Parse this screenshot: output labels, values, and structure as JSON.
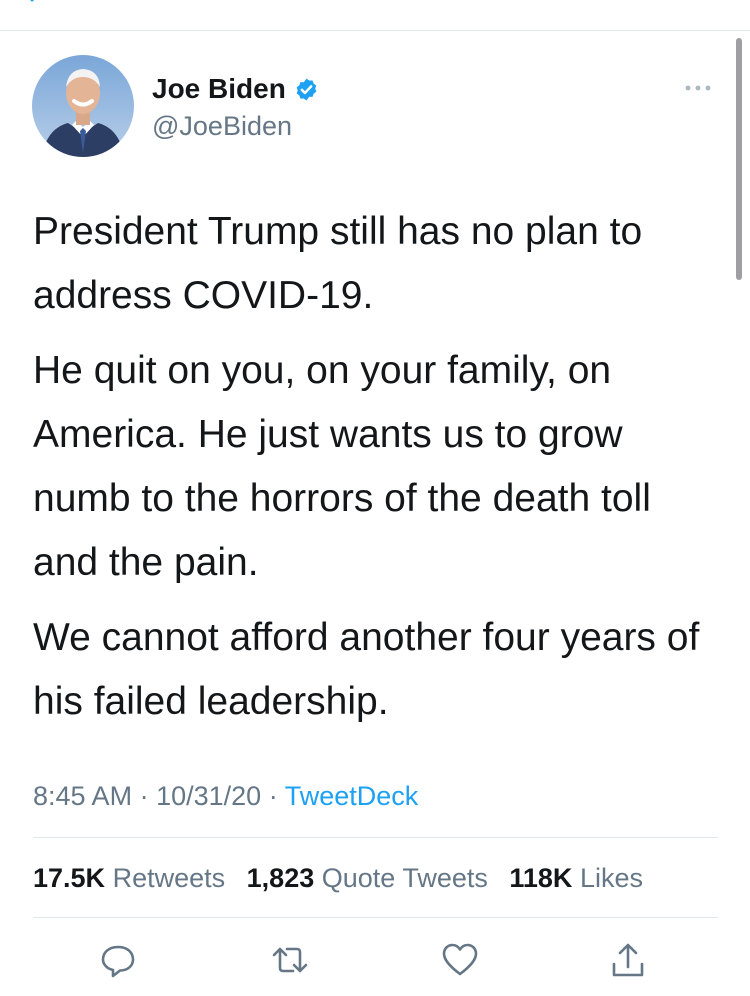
{
  "author": {
    "name": "Joe Biden",
    "handle": "@JoeBiden",
    "verified": true
  },
  "tweet": {
    "paragraphs": [
      "President Trump still has no plan to address COVID-19.",
      "He quit on you, on your family, on America. He just wants us to grow numb to the horrors of the death toll and the pain.",
      "We cannot afford another four years of his failed leadership."
    ],
    "time": "8:45 AM",
    "date": "10/31/20",
    "separator": "·",
    "source": "TweetDeck"
  },
  "stats": {
    "retweets_count": "17.5K",
    "retweets_label": "Retweets",
    "quote_count": "1,823",
    "quote_label": "Quote Tweets",
    "likes_count": "118K",
    "likes_label": "Likes"
  },
  "actions": [
    "reply-icon",
    "retweet-icon",
    "like-icon",
    "share-icon"
  ],
  "colors": {
    "accent": "#1da1f2",
    "secondary_text": "#657786",
    "primary_text": "#14171a",
    "divider": "#e1e8ed"
  }
}
